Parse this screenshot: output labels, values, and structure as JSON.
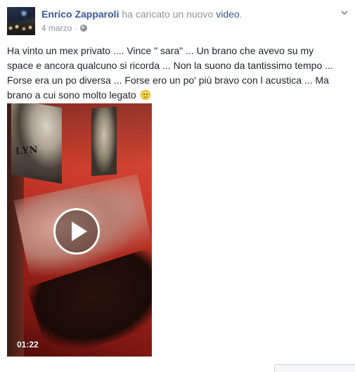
{
  "post": {
    "author": "Enrico Zapparoli",
    "action_text": "ha caricato un nuovo",
    "action_link": "video",
    "action_suffix": ".",
    "date": "4 marzo",
    "separator": "·",
    "privacy_icon": "globe-icon",
    "menu_icon": "chevron-down-icon",
    "text_lines": [
      "Ha vinto un mex privato .... Vince \" sara\" ... Un brano che avevo su my",
      "space e ancora qualcuno si ricorda ... Non la suono da tantissimo tempo ...",
      "Forse era un po diversa ... Forse ero un po' più bravo con l acustica ... Ma",
      "brano a cui sono molto legato"
    ],
    "emoji_icon": "smiley-icon",
    "video": {
      "duration": "01:22",
      "poster_text": "LYN",
      "play_icon": "play-icon"
    }
  },
  "colors": {
    "link": "#365899",
    "muted": "#90949c",
    "text": "#1d2129"
  }
}
